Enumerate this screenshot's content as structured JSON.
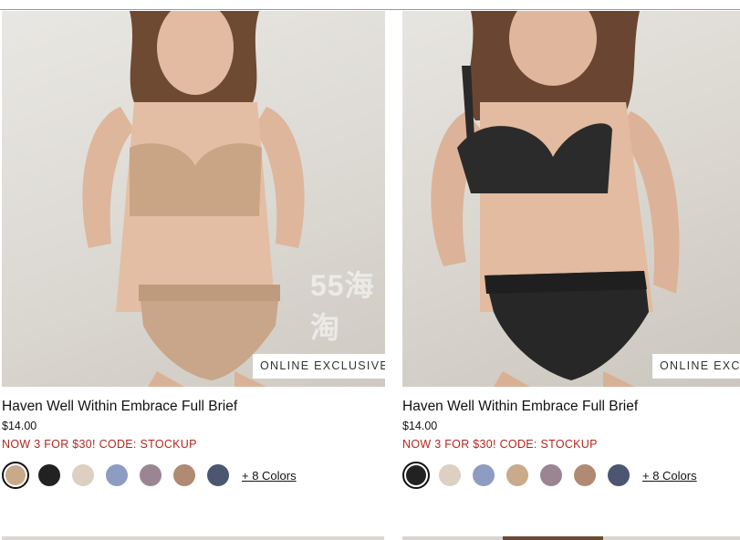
{
  "watermark": "55海淘",
  "products": [
    {
      "badge": "ONLINE EXCLUSIVE",
      "name": "Haven Well Within Embrace Full Brief",
      "price": "$14.00",
      "promo": "NOW 3 FOR $30! CODE: STOCKUP",
      "more_colors": "+ 8 Colors",
      "swatches": [
        "#c8a989",
        "#222222",
        "#ddd0c2",
        "#8f9cc2",
        "#9c8592",
        "#b08a72",
        "#4c5670"
      ],
      "selected_swatch": 0
    },
    {
      "badge": "ONLINE EXCLUSIVE",
      "name": "Haven Well Within Embrace Full Brief",
      "price": "$14.00",
      "promo": "NOW 3 FOR $30! CODE: STOCKUP",
      "more_colors": "+ 8 Colors",
      "swatches": [
        "#222222",
        "#ddd0c2",
        "#8f9cc2",
        "#c9aa8a",
        "#9c8592",
        "#b08a72",
        "#4c5670"
      ],
      "selected_swatch": 0
    }
  ]
}
